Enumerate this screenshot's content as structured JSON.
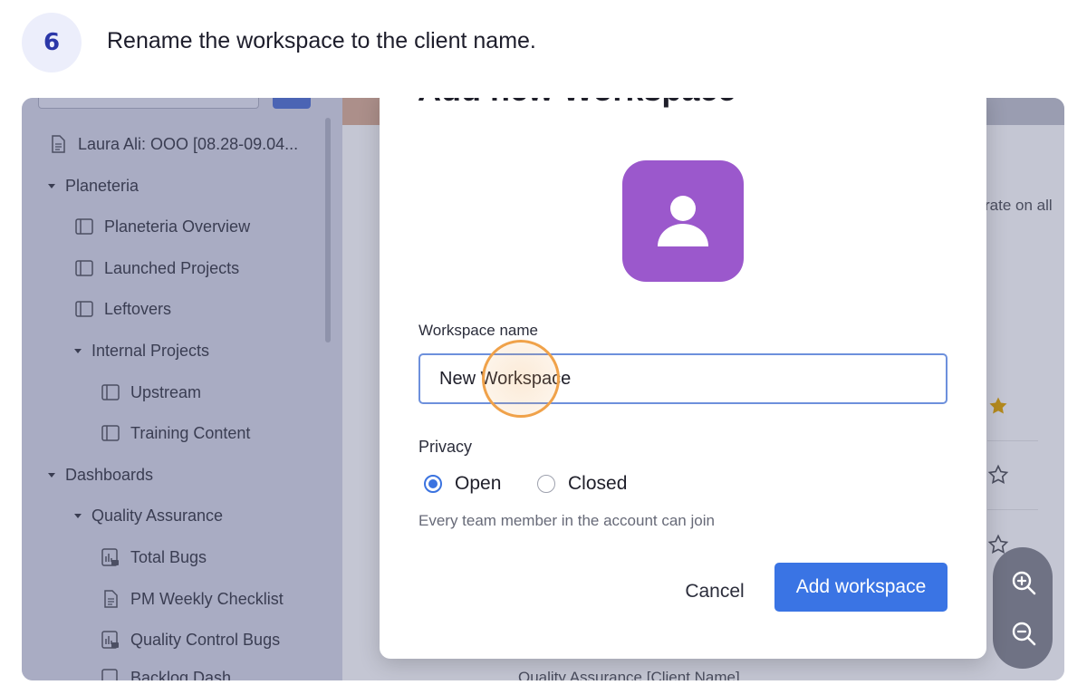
{
  "step": {
    "number": "6",
    "instruction": "Rename the workspace to the client name."
  },
  "sidebar": {
    "items": [
      {
        "label": "Laura Ali: OOO [08.28-09.04...",
        "icon": "document-icon"
      },
      {
        "label": "Planeteria",
        "icon": "caret-down-icon"
      },
      {
        "label": "Planeteria Overview",
        "icon": "board-icon"
      },
      {
        "label": "Launched Projects",
        "icon": "board-icon"
      },
      {
        "label": "Leftovers",
        "icon": "board-icon"
      },
      {
        "label": "Internal Projects",
        "icon": "caret-down-icon"
      },
      {
        "label": "Upstream",
        "icon": "board-icon"
      },
      {
        "label": "Training Content",
        "icon": "board-icon"
      },
      {
        "label": "Dashboards",
        "icon": "caret-down-icon"
      },
      {
        "label": "Quality Assurance",
        "icon": "caret-down-icon"
      },
      {
        "label": "Total Bugs",
        "icon": "dashboard-icon"
      },
      {
        "label": "PM Weekly Checklist",
        "icon": "document-icon"
      },
      {
        "label": "Quality Control Bugs",
        "icon": "dashboard-icon"
      },
      {
        "label": "Backlog Dash",
        "icon": "dashboard-icon"
      }
    ]
  },
  "background": {
    "partial_text": "rate on all",
    "bottom_text": "Quality Assurance [Client Name]"
  },
  "modal": {
    "title": "Add new Workspace",
    "field_label": "Workspace name",
    "name_value": "New Workspace",
    "privacy_label": "Privacy",
    "options": [
      {
        "label": "Open",
        "selected": true
      },
      {
        "label": "Closed",
        "selected": false
      }
    ],
    "hint": "Every team member in the account can join",
    "cancel_label": "Cancel",
    "add_label": "Add workspace"
  },
  "colors": {
    "accent": "#3a74e4",
    "avatar_bg": "#9b58cc",
    "highlight_ring": "#f0a24a",
    "star_filled": "#b48a1e"
  }
}
